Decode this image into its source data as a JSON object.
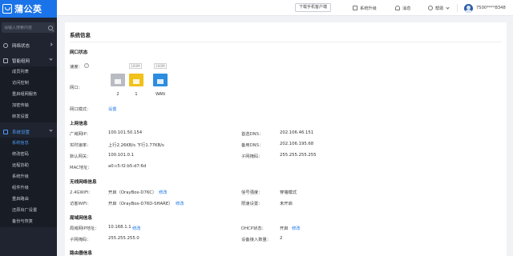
{
  "app": {
    "logo": "蒲公英"
  },
  "sidebar": {
    "search_placeholder": "请输入搜索内容",
    "groups": [
      {
        "label": "网络状态"
      },
      {
        "label": "智能组网"
      },
      {
        "label": "系统设置"
      }
    ],
    "network_items": [
      "成员列表",
      "访问控制",
      "重启组网服务",
      "加密传输",
      "转发设置"
    ],
    "system_items": [
      "系统信息",
      "修改密码",
      "远程协助",
      "系统升级",
      "组件升级",
      "重启路由",
      "还原出厂设置",
      "备份与恢复"
    ]
  },
  "topbar": {
    "download_label": "下载手机客户端",
    "upgrade_label": "系统升级",
    "message_label": "消息",
    "help_label": "帮助",
    "account": "7500****8348"
  },
  "main": {
    "title": "系统信息",
    "port_status": {
      "section": "网口状态",
      "speed_label": "速度：",
      "port_label": "网口：",
      "speed_tags": [
        "100M",
        "100M"
      ],
      "ports": [
        {
          "name": "2",
          "color": "#b8bcc2"
        },
        {
          "name": "1",
          "color": "#f2c11a"
        },
        {
          "name": "WAN",
          "color": "#2c8de0"
        }
      ],
      "mode_label": "网口模式：",
      "mode_link": "设置"
    },
    "wan": {
      "section": "上网信息",
      "ip_label": "广域网IP：",
      "ip": "100.101.50.154",
      "rate_label": "实时速率：",
      "rate": "上行2.26KB/s  下行1.77KB/s",
      "gw_label": "默认网关：",
      "gw": "100.101.0.1",
      "mac_label": "MAC地址：",
      "mac": "a0:c5:f2:b5:d7:6d",
      "dns1_label": "首选DNS：",
      "dns1": "202.106.46.151",
      "dns2_label": "备用DNS：",
      "dns2": "202.106.195.68",
      "mask_label": "子网掩码：",
      "mask": "255.255.255.255"
    },
    "wifi": {
      "section": "无线网络信息",
      "w24_label": "2.4GWiFi：",
      "w24": "开启（OrayBox-D76C）",
      "w24_link": "修改",
      "guest_label": "访客WiFi：",
      "guest": "开启（OrayBox-D76D-SHARE）",
      "guest_link": "修改",
      "signal_label": "信号强度：",
      "signal": "穿墙模式",
      "limit_label": "限速设置：",
      "limit": "未开启"
    },
    "lan": {
      "section": "局域网信息",
      "ip_label": "局域网IP地址：",
      "ip": "10.168.1.1",
      "ip_link": "修改",
      "mask_label": "子网掩码：",
      "mask": "255.255.255.0",
      "dhcp_label": "DHCP状态：",
      "dhcp": "开启",
      "dhcp_link": "修改",
      "devices_label": "设备接入数量：",
      "devices": "2"
    },
    "router_section": "路由器信息"
  }
}
